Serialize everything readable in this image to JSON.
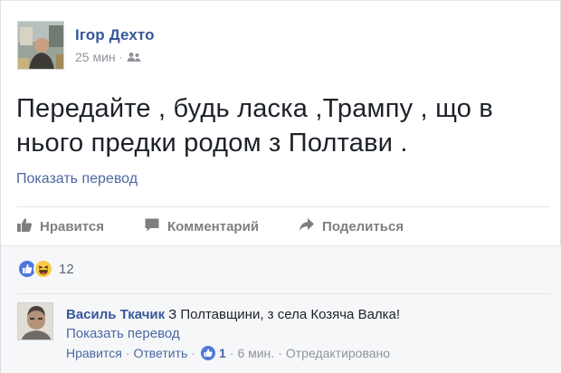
{
  "post": {
    "author": "Ігор Дехто",
    "time": "25 мин",
    "separator": "·",
    "text_line1": "Передайте , будь ласка ,Трампу , що в",
    "text_line2": "нього предки родом з Полтави .",
    "translate": "Показать перевод",
    "audience_icon": "friends-icon"
  },
  "actions": {
    "like": "Нравится",
    "comment": "Комментарий",
    "share": "Поделиться"
  },
  "reactions": {
    "count": "12",
    "icons": [
      "like-icon",
      "haha-icon"
    ]
  },
  "comment": {
    "author": "Василь Ткачик",
    "text": "З Полтавщини, з села Козяча Валка!",
    "translate": "Показать перевод",
    "like": "Нравится",
    "reply": "Ответить",
    "likes_count": "1",
    "time": "6 мин.",
    "edited": "Отредактировано",
    "separator": "·"
  },
  "colors": {
    "link": "#365899",
    "accent_blue": "#4f78d8",
    "haha_yellow": "#f8cc47",
    "muted": "#90949c"
  }
}
